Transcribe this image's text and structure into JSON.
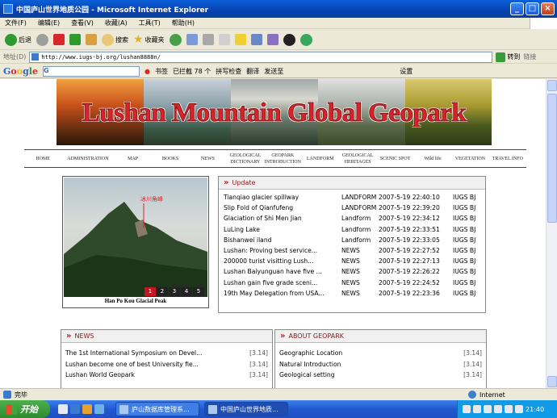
{
  "window": {
    "title": "中国庐山世界地质公园 - Microsoft Internet Explorer"
  },
  "menu": [
    "文件(F)",
    "编辑(E)",
    "查看(V)",
    "收藏(A)",
    "工具(T)",
    "帮助(H)"
  ],
  "toolbar": {
    "back": "后退",
    "search": "搜索",
    "favorites": "收藏夹"
  },
  "address": {
    "label": "地址(D)",
    "url": "http://www.iugs-bj.org/lushan8888n/",
    "go": "转到",
    "links": "链接"
  },
  "google": {
    "logo": "Google",
    "prefix": "G",
    "bookmarks": "书签",
    "blocked": "已拦截 78 个",
    "spell": "拼写检查",
    "translate": "翻译",
    "send": "发送至",
    "settings": "设置"
  },
  "banner": {
    "title": "Lushan Mountain Global Geopark"
  },
  "nav": [
    "HOME",
    "ADMINISTRATION",
    "MAP",
    "BOOKS",
    "NEWS",
    "GEOLOGICAL DICTIONARY",
    "GEOPARK INTRODUCTION",
    "LANDFORM",
    "GEOLOGICAL HERITAGES",
    "SCENIC SPOT",
    "Wild life",
    "VEGETATION",
    "TRAVEL INFO"
  ],
  "photo": {
    "caption": "Han Po Kou Glacial Peak",
    "label": "冰川角峰",
    "pages": [
      "1",
      "2",
      "3",
      "4",
      "5"
    ]
  },
  "update": {
    "title": "Update",
    "rows": [
      {
        "title": "Tianqiao glacier spillway",
        "cat": "LANDFORM",
        "date": "2007-5-19 22:40:10",
        "author": "IUGS BJ"
      },
      {
        "title": "Slip Fold of Qianfufeng",
        "cat": "LANDFORM",
        "date": "2007-5-19 22:39:20",
        "author": "IUGS BJ"
      },
      {
        "title": "Glaciation of Shi Men Jian",
        "cat": "Landform",
        "date": "2007-5-19 22:34:12",
        "author": "IUGS BJ"
      },
      {
        "title": "LuLing Lake",
        "cat": "Landform",
        "date": "2007-5-19 22:33:51",
        "author": "IUGS BJ"
      },
      {
        "title": "Bishanwei iland",
        "cat": "Landform",
        "date": "2007-5-19 22:33:05",
        "author": "IUGS BJ"
      },
      {
        "title": "Lushan: Proving best service...",
        "cat": "NEWS",
        "date": "2007-5-19 22:27:52",
        "author": "IUGS BJ"
      },
      {
        "title": "200000 turist visitting Lush...",
        "cat": "NEWS",
        "date": "2007-5-19 22:27:13",
        "author": "IUGS BJ"
      },
      {
        "title": "Lushan Baiyunguan have five ...",
        "cat": "NEWS",
        "date": "2007-5-19 22:26:22",
        "author": "IUGS BJ"
      },
      {
        "title": "Lushan gain five grade sceni...",
        "cat": "NEWS",
        "date": "2007-5-19 22:24:52",
        "author": "IUGS BJ"
      },
      {
        "title": "19th May Delegation from USA...",
        "cat": "NEWS",
        "date": "2007-5-19 22:23:36",
        "author": "IUGS BJ"
      }
    ]
  },
  "news": {
    "title": "NEWS",
    "rows": [
      {
        "title": "The 1st International Symposium on Devel...",
        "date": "[3.14]"
      },
      {
        "title": "Lushan become one of best University fie...",
        "date": "[3.14]"
      },
      {
        "title": "Lushan World Geopark",
        "date": "[3.14]"
      }
    ]
  },
  "geopark": {
    "title": "ABOUT GEOPARK",
    "rows": [
      {
        "title": "Geographic Location",
        "date": "[3.14]"
      },
      {
        "title": "Natural Introduction",
        "date": "[3.14]"
      },
      {
        "title": "Geological setting",
        "date": "[3.14]"
      }
    ]
  },
  "status": {
    "text": "完毕",
    "zone": "Internet"
  },
  "taskbar": {
    "start": "开始",
    "tasks": [
      "庐山数据库管理系...",
      "中国庐山世界地质..."
    ],
    "clock": "21:40"
  },
  "colors": {
    "accent_red": "#c8141c",
    "banner_title": "#d8232a",
    "xp_blue": "#0a5fd8"
  }
}
